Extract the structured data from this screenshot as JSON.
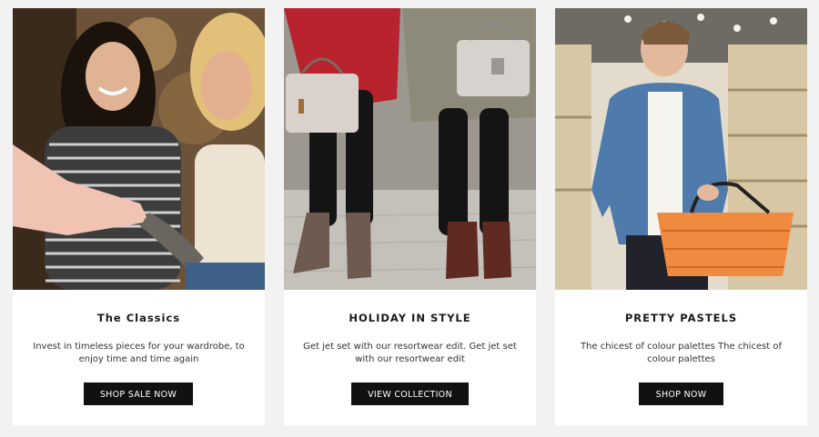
{
  "cards": [
    {
      "title": "The Classics",
      "description": "Invest in timeless pieces for your wardrobe, to enjoy time and time again",
      "button_label": "SHOP SALE NOW",
      "image": "two-women-shopping-photo"
    },
    {
      "title": "HOLIDAY IN STYLE",
      "description": "Get jet set with our resortwear edit. Get jet set with our resortwear edit",
      "button_label": "VIEW COLLECTION",
      "image": "legs-with-handbags-photo"
    },
    {
      "title": "PRETTY PASTELS",
      "description": "The chicest of colour palettes The chicest of colour palettes",
      "button_label": "SHOP NOW",
      "image": "man-with-shopping-basket-photo"
    }
  ],
  "colors": {
    "page_background": "#f2f2f2",
    "card_background": "#ffffff",
    "button_background": "#111111",
    "button_text": "#ffffff"
  }
}
